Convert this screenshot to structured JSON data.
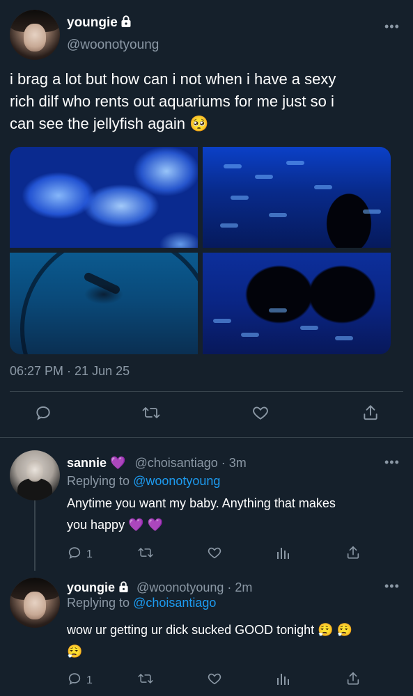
{
  "main_tweet": {
    "display_name": "youngie",
    "handle": "@woonotyoung",
    "text_line1": "i brag a lot but how can i not when i have a sexy",
    "text_line2": "rich dilf who rents out aquariums for me just so i",
    "text_line3": "can see the jellyfish again 🥺",
    "timestamp": "06:27 PM · 21 Jun 25"
  },
  "replies": [
    {
      "display_name": "sannie 💜",
      "handle_time": "@choisantiago · 3m",
      "replying_label": "Replying to",
      "replying_handle": "@woonotyoung",
      "text_line1": "Anytime you want my baby. Anything that makes",
      "text_line2": "you happy 💜 💜",
      "reply_count": "1"
    },
    {
      "display_name": "youngie",
      "handle_time": "@woonotyoung · 2m",
      "replying_label": "Replying to",
      "replying_handle": "@choisantiago",
      "text_line1": "wow ur getting ur dick sucked GOOD tonight 😮‍💨 😮‍💨",
      "text_line2": "😮‍💨",
      "reply_count": "1"
    }
  ],
  "icons": {
    "reply": "comment-icon",
    "retweet": "retweet-icon",
    "like": "heart-icon",
    "views": "bar-chart-icon",
    "share": "share-icon",
    "more": "more-icon",
    "lock": "lock-icon"
  },
  "colors": {
    "background": "#15202b",
    "muted": "#8b98a5",
    "accent": "#1d9bf0",
    "divider": "#38444d"
  }
}
